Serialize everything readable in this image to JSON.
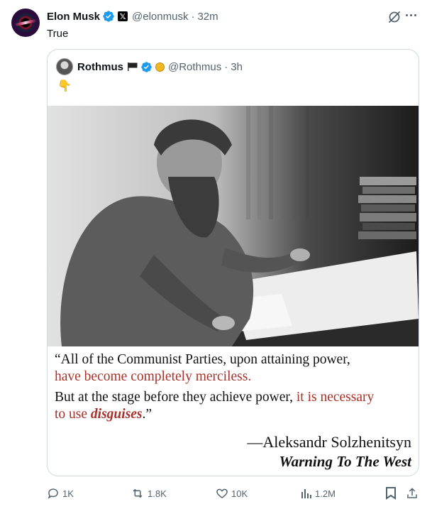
{
  "post": {
    "author_name": "Elon Musk",
    "author_handle": "@elonmusk",
    "separator": "·",
    "time": "32m",
    "x_badge": "𝕏",
    "text": "True",
    "icons": {
      "avatar": "elon-avatar",
      "verified": "verified-badge-icon",
      "grok": "grok-icon",
      "more": "more-icon"
    },
    "colors": {
      "verified": "#1d9bf0",
      "muted": "#536471",
      "border": "#cfd9de"
    }
  },
  "quote": {
    "author_name": "Rothmus",
    "author_handle": "@Rothmus",
    "separator": "·",
    "time": "3h",
    "text": "👇",
    "icons": {
      "flag": "black-flag-icon",
      "verified": "verified-badge-icon",
      "badge": "coin-icon"
    },
    "image": {
      "quote_line1": "“All of the Communist Parties, upon attaining power,",
      "quote_line2": "have become completely merciless.",
      "quote_line3_a": "But at the stage before they achieve power, ",
      "quote_line3_b": "it is necessary",
      "quote_line4_a": "to use ",
      "quote_line4_b": "disguises",
      "quote_line4_c": ".”",
      "author": "—Aleksandr Solzhenitsyn",
      "work": "Warning To The West",
      "colors": {
        "highlight": "#a8322a"
      }
    }
  },
  "actions": {
    "replies": "1K",
    "reposts": "1.8K",
    "likes": "10K",
    "views": "1.2M"
  }
}
